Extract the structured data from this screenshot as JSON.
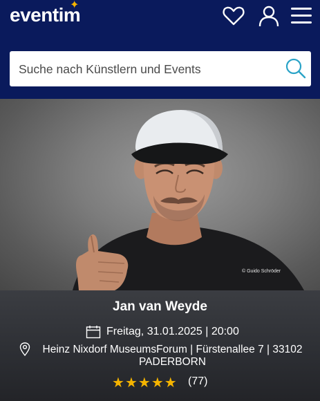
{
  "header": {
    "logo_text": "eventim",
    "logo_star": "✦",
    "icons": [
      "heart-icon",
      "user-icon",
      "menu-icon"
    ]
  },
  "search": {
    "placeholder": "Suche nach Künstlern und Events",
    "icon": "search-icon"
  },
  "hero": {
    "photo_credit": "© Guido Schröder"
  },
  "event": {
    "title": "Jan van Weyde",
    "date": "Freitag, 31.01.2025 | 20:00",
    "venue": "Heinz Nixdorf MuseumsForum | Fürstenallee 7 | 33102 PADERBORN",
    "rating_stars": [
      "★",
      "★",
      "★",
      "★",
      "★"
    ],
    "rating_count": "(77)"
  },
  "colors": {
    "header_bg": "#0a1a5c",
    "accent_star": "#f5b400",
    "search_icon": "#2aa3c7",
    "info_bg": "#2f3136"
  }
}
